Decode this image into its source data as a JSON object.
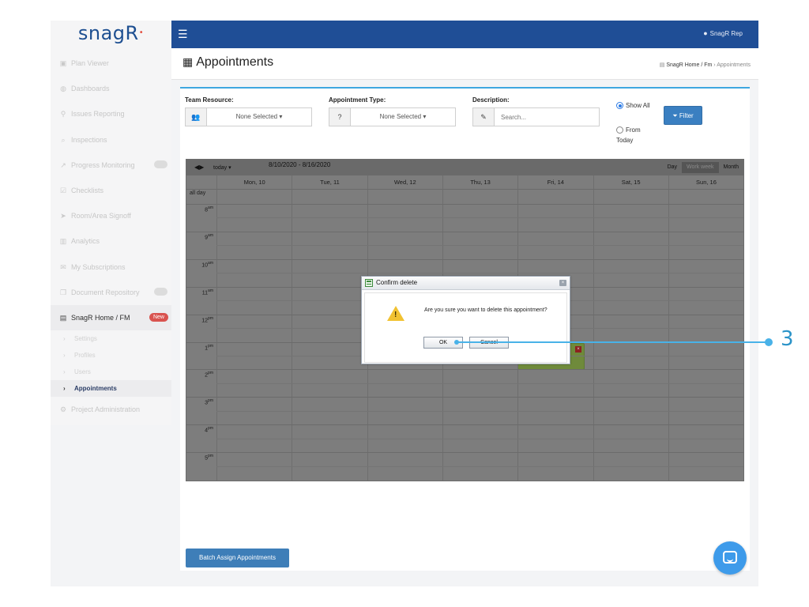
{
  "sidebar": {
    "logo": "snagR",
    "items": [
      {
        "label": "Plan Viewer",
        "icon": "image-icon"
      },
      {
        "label": "Dashboards",
        "icon": "dashboard-icon"
      },
      {
        "label": "Issues Reporting",
        "icon": "map-pin-icon"
      },
      {
        "label": "Inspections",
        "icon": "search-icon"
      },
      {
        "label": "Progress Monitoring",
        "icon": "line-chart-icon"
      },
      {
        "label": "Checklists",
        "icon": "checklist-icon"
      },
      {
        "label": "Room/Area Signoff",
        "icon": "send-icon"
      },
      {
        "label": "Analytics",
        "icon": "bar-chart-icon"
      },
      {
        "label": "My Subscriptions",
        "icon": "envelope-icon"
      },
      {
        "label": "Document Repository",
        "icon": "documents-icon"
      },
      {
        "label": "SnagR Home / FM",
        "icon": "building-icon",
        "badge": "New"
      }
    ],
    "sub_items": [
      {
        "label": "Settings"
      },
      {
        "label": "Profiles"
      },
      {
        "label": "Users"
      },
      {
        "label": "Appointments"
      }
    ],
    "admin": {
      "label": "Project Administration",
      "icon": "cogs-icon"
    }
  },
  "topbar": {
    "user": "SnagR Rep"
  },
  "page": {
    "title": "Appointments",
    "breadcrumb": [
      "SnagR Home / Fm",
      "Appointments"
    ]
  },
  "filters": {
    "team_resource": {
      "label": "Team Resource:",
      "value": "None Selected"
    },
    "appointment_type": {
      "label": "Appointment Type:",
      "value": "None Selected",
      "addon": "?"
    },
    "description": {
      "label": "Description:",
      "placeholder": "Search..."
    },
    "radio_show_all": "Show All",
    "radio_from_today": "From Today",
    "selected_radio": "Show All",
    "filter_button": "Filter"
  },
  "calendar": {
    "today_label": "today",
    "range": "8/10/2020 - 8/16/2020",
    "views": [
      "Day",
      "Work week",
      "Month"
    ],
    "selected_view": "Work week",
    "days": [
      "Mon, 10",
      "Tue, 11",
      "Wed, 12",
      "Thu, 13",
      "Fri, 14",
      "Sat, 15",
      "Sun, 16"
    ],
    "all_day_label": "all day",
    "hours": [
      {
        "h": "8",
        "ap": "am"
      },
      {
        "h": "9",
        "ap": "am"
      },
      {
        "h": "10",
        "ap": "am"
      },
      {
        "h": "11",
        "ap": "am"
      },
      {
        "h": "12",
        "ap": "pm"
      },
      {
        "h": "1",
        "ap": "pm"
      },
      {
        "h": "2",
        "ap": "pm"
      },
      {
        "h": "3",
        "ap": "pm"
      },
      {
        "h": "4",
        "ap": "pm"
      },
      {
        "h": "5",
        "ap": "pm"
      }
    ]
  },
  "batch_button": "Batch Assign Appointments",
  "dialog": {
    "title": "Confirm delete",
    "message": "Are you sure you want to delete this appointment?",
    "ok": "OK",
    "cancel": "Cancel"
  },
  "callout": {
    "number": "3",
    "color": "#49b2e8"
  },
  "colors": {
    "topbar": "#1f4e96",
    "accent": "#3ea7e0",
    "button": "#3a7fc1",
    "badge": "#d9534f",
    "appointment": "#6f8a3b"
  }
}
